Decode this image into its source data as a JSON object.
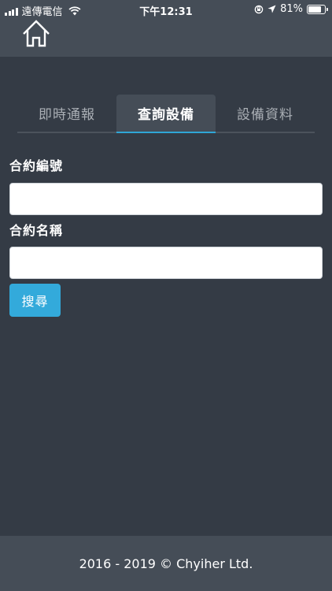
{
  "status_bar": {
    "carrier": "遠傳電信",
    "time": "下午12:31",
    "battery": "81%",
    "battery_level": 0.81
  },
  "navbar": {
    "home_icon": "home-icon"
  },
  "tabs": [
    {
      "label": "即時通報",
      "active": false
    },
    {
      "label": "查詢設備",
      "active": true
    },
    {
      "label": "設備資料",
      "active": false
    }
  ],
  "form": {
    "contract_number_label": "合約編號",
    "contract_number_value": "",
    "contract_name_label": "合約名稱",
    "contract_name_value": "",
    "search_button": "搜尋"
  },
  "footer": {
    "copyright": "2016 - 2019 © Chyiher Ltd."
  },
  "colors": {
    "background": "#343b45",
    "bar": "#454d57",
    "accent": "#33aadb"
  }
}
